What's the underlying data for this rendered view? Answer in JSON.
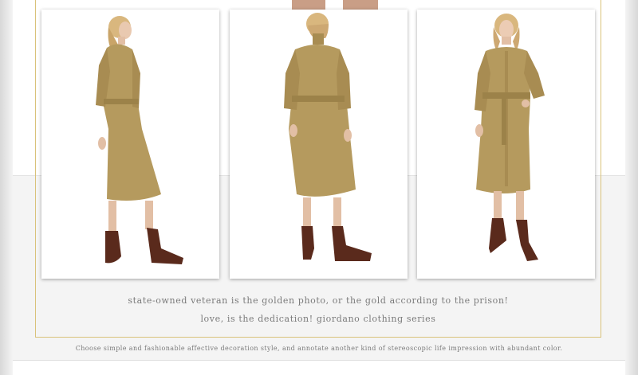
{
  "gallery": {
    "photos": [
      {
        "view": "side-back view",
        "icon": "model-photo-side"
      },
      {
        "view": "back view",
        "icon": "model-photo-back"
      },
      {
        "view": "front view",
        "icon": "model-photo-front"
      }
    ]
  },
  "caption": {
    "line1": "state-owned veteran is the golden photo, or the gold according to the prison!",
    "line2": "love, is the dedication! giordano clothing series"
  },
  "footer": {
    "note": "Choose simple and fashionable affective decoration style, and annotate another kind of stereoscopic life impression with abundant color."
  },
  "colors": {
    "frame_gold": "#d9c27a",
    "dress_khaki": "#b59a5e",
    "boot_brown": "#5a2a1c",
    "text_gray": "#7a7a7a"
  }
}
